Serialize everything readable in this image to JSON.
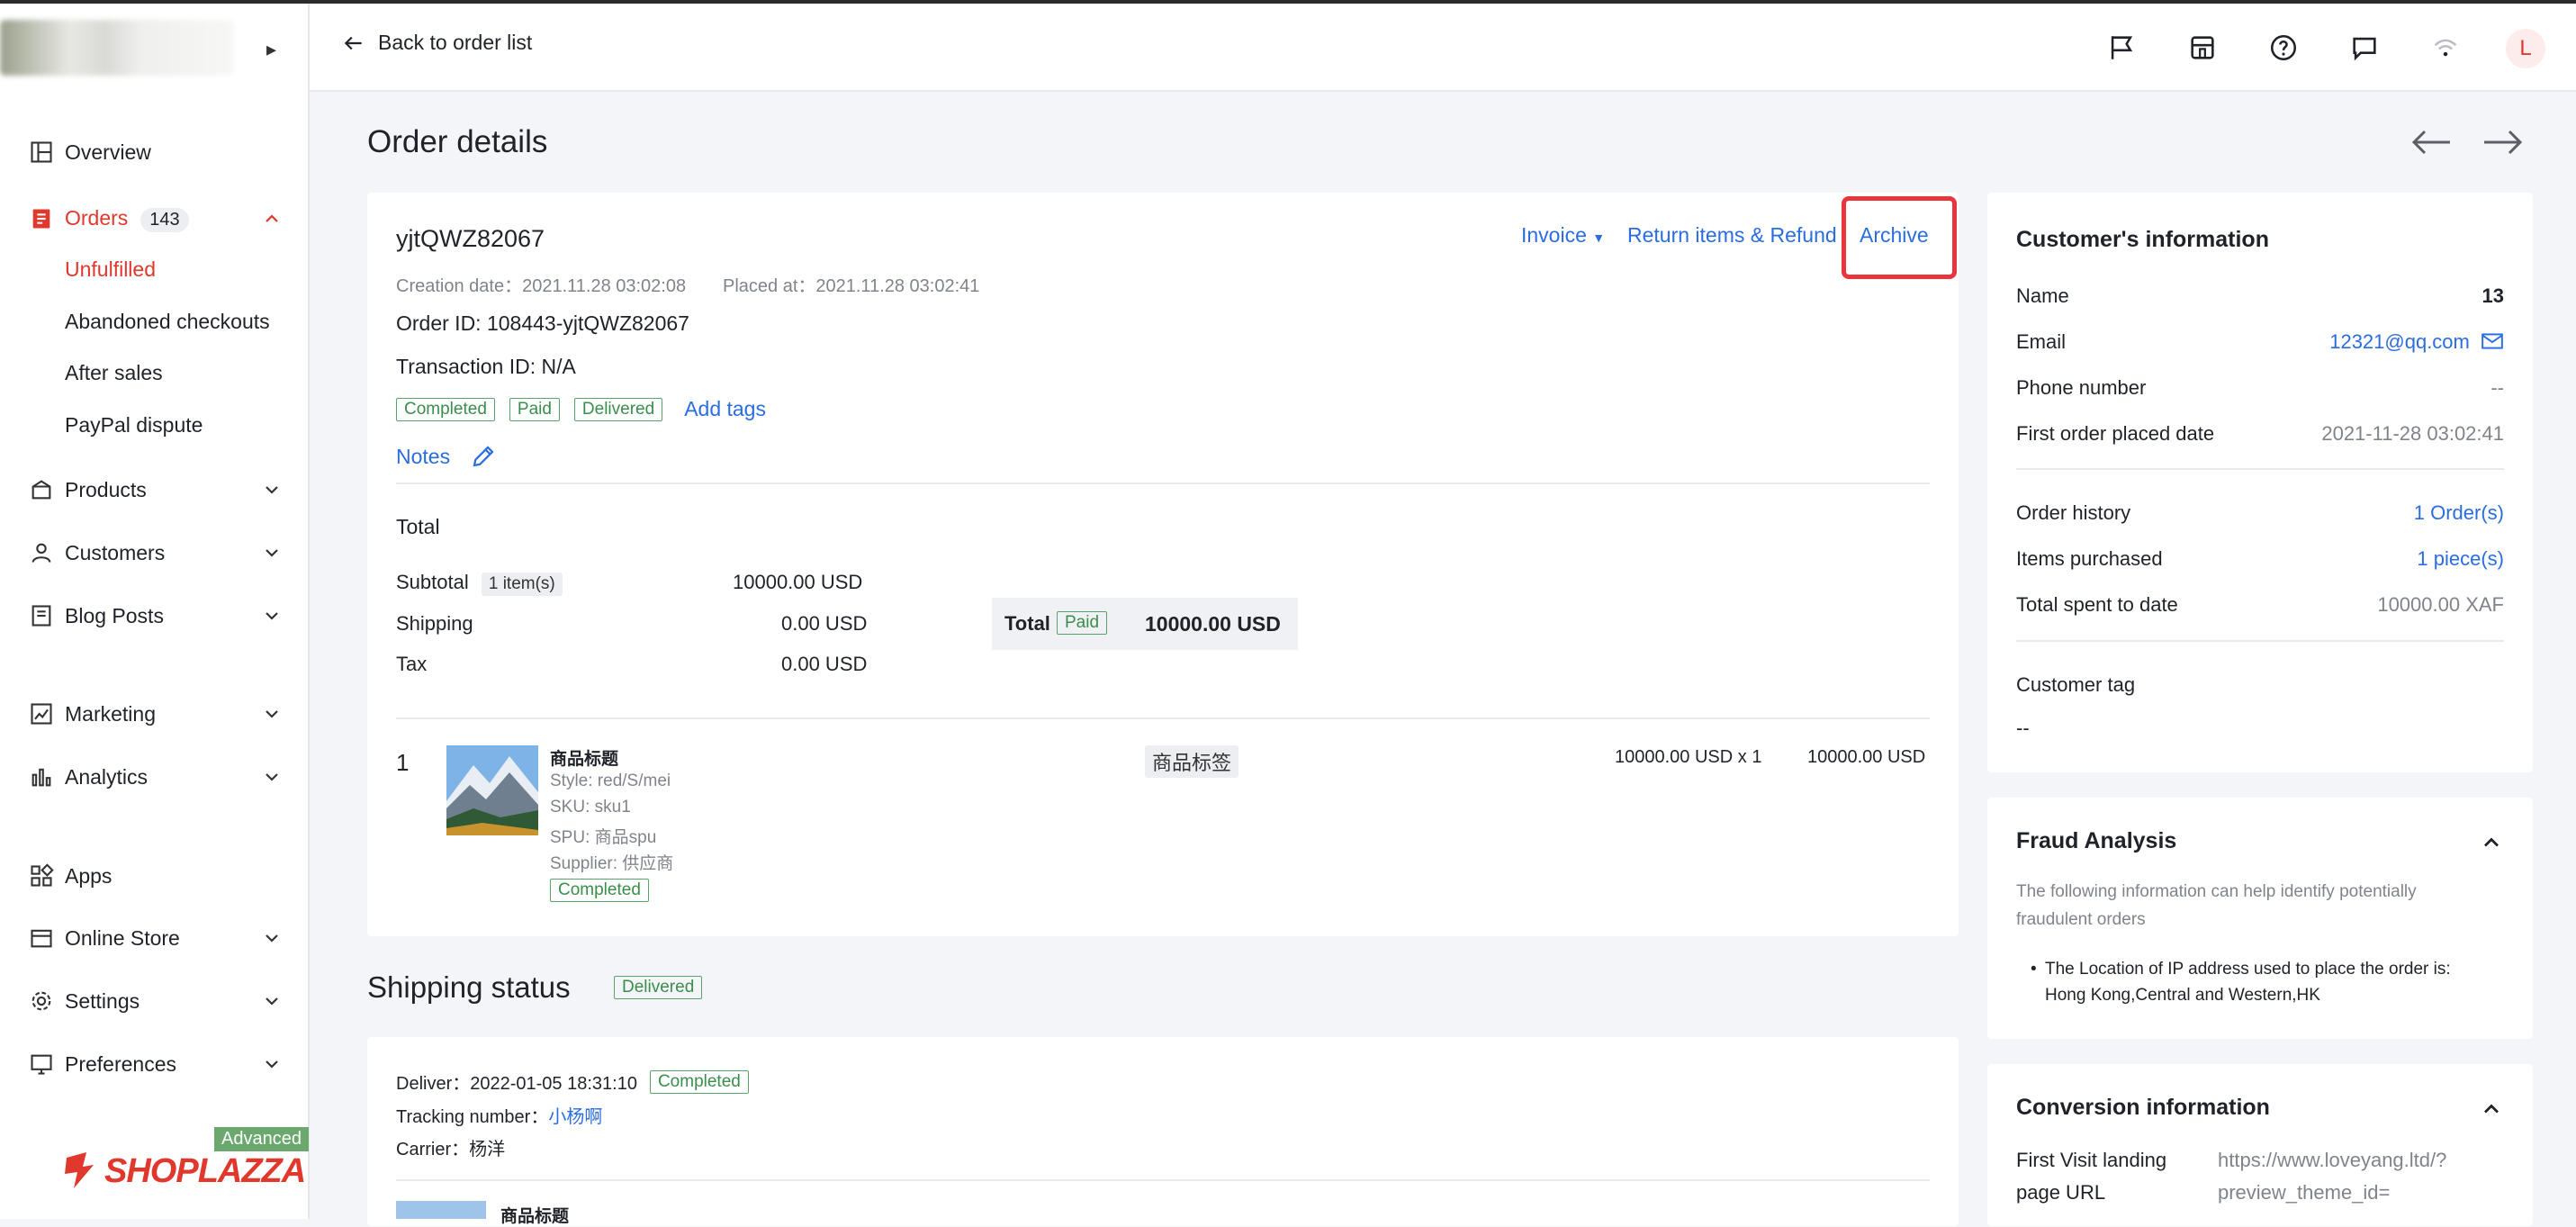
{
  "sidebar": {
    "items": [
      {
        "label": "Overview"
      },
      {
        "label": "Orders",
        "count": "143"
      },
      {
        "label": "Products"
      },
      {
        "label": "Customers"
      },
      {
        "label": "Blog Posts"
      },
      {
        "label": "Marketing"
      },
      {
        "label": "Analytics"
      },
      {
        "label": "Apps"
      },
      {
        "label": "Online Store"
      },
      {
        "label": "Settings"
      },
      {
        "label": "Preferences"
      }
    ],
    "order_sub": [
      "Unfulfilled",
      "Abandoned checkouts",
      "After sales",
      "PayPal dispute"
    ],
    "plan_badge": "Advanced",
    "brand": "SHOPLAZZA",
    "accent": "#e1382d"
  },
  "header": {
    "back_label": "Back to order list",
    "avatar_letter": "L",
    "icons": [
      "flag-icon",
      "store-icon",
      "help-icon",
      "message-icon",
      "wifi-icon"
    ]
  },
  "page": {
    "title": "Order details"
  },
  "order": {
    "number": "yjtQWZ82067",
    "creation": "Creation date：2021.11.28 03:02:08",
    "placed": "Placed at：2021.11.28 03:02:41",
    "order_id": "Order ID: 108443-yjtQWZ82067",
    "transaction_id": "Transaction ID: N/A",
    "tags": [
      "Completed",
      "Paid",
      "Delivered"
    ],
    "add_tags": "Add tags",
    "notes": "Notes",
    "actions": {
      "invoice": "Invoice",
      "refund": "Return items & Refund",
      "archive": "Archive"
    },
    "total_heading": "Total",
    "subtotal_label": "Subtotal",
    "subtotal_items": "1 item(s)",
    "subtotal_value": "10000.00 USD",
    "shipping_label": "Shipping",
    "shipping_value": "0.00 USD",
    "tax_label": "Tax",
    "tax_value": "0.00 USD",
    "total_box_label": "Total",
    "total_box_status": "Paid",
    "total_box_value": "10000.00 USD",
    "line_item": {
      "index": "1",
      "title": "商品标题",
      "style": "Style: red/S/mei",
      "sku": "SKU: sku1",
      "spu": "SPU: 商品spu",
      "supplier": "Supplier: 供应商",
      "status": "Completed",
      "tag": "商品标签",
      "unit": "10000.00 USD x 1",
      "total": "10000.00 USD"
    }
  },
  "shipping": {
    "title": "Shipping status",
    "status": "Delivered",
    "deliver": "Deliver：2022-01-05 18:31:10",
    "deliver_status": "Completed",
    "tracking_label": "Tracking number：",
    "tracking_value": "小杨啊",
    "carrier": "Carrier：杨洋",
    "item_title": "商品标题"
  },
  "customer": {
    "title": "Customer's information",
    "rows": [
      {
        "label": "Name",
        "value": "13"
      },
      {
        "label": "Email",
        "value": "12321@qq.com"
      },
      {
        "label": "Phone number",
        "value": "--"
      },
      {
        "label": "First order placed date",
        "value": "2021-11-28 03:02:41"
      },
      {
        "label": "Order history",
        "value": "1 Order(s)"
      },
      {
        "label": "Items purchased",
        "value": "1 piece(s)"
      },
      {
        "label": "Total spent to date",
        "value": "10000.00 XAF"
      }
    ],
    "tag_label": "Customer tag",
    "tag_value": "--"
  },
  "fraud": {
    "title": "Fraud Analysis",
    "desc1": "The following information can help identify potentially",
    "desc2": "fraudulent orders",
    "bullet1": "The Location of IP address used to place the order is:",
    "bullet2": "Hong Kong,Central and Western,HK"
  },
  "conversion": {
    "title": "Conversion information",
    "label1": "First Visit landing",
    "label2": "page URL",
    "url1": "https://www.loveyang.ltd/?",
    "url2": "preview_theme_id="
  }
}
